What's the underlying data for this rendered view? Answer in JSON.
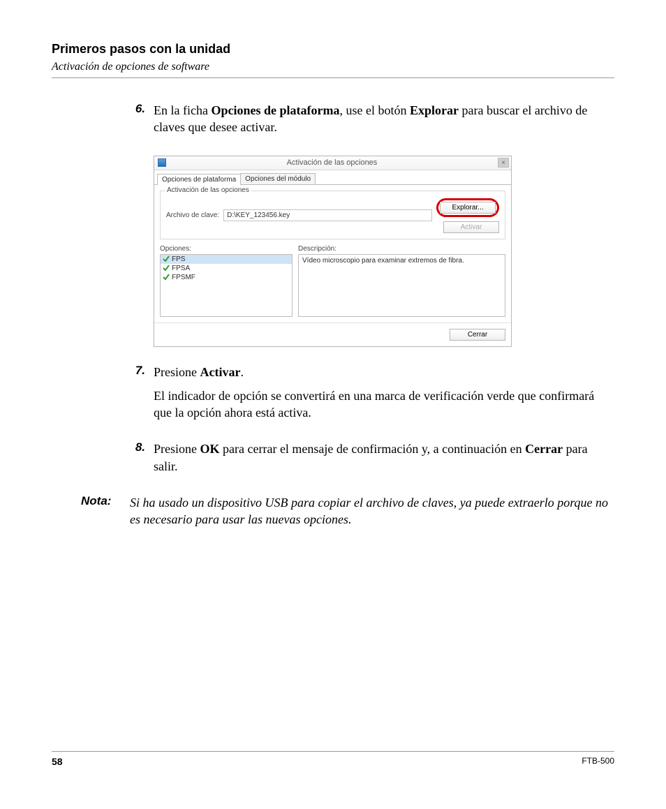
{
  "header": {
    "title": "Primeros pasos con la unidad",
    "subtitle": "Activación de opciones de software"
  },
  "steps": {
    "s6": {
      "num": "6.",
      "pre": "En la ficha ",
      "bold1": "Opciones de plataforma",
      "mid": ", use el botón ",
      "bold2": "Explorar",
      "post": " para buscar el archivo de claves que desee activar."
    },
    "s7": {
      "num": "7.",
      "line1_pre": "Presione ",
      "line1_bold": "Activar",
      "line1_post": ".",
      "line2": "El indicador de opción se convertirá en una marca de verificación verde que confirmará que la opción ahora está activa."
    },
    "s8": {
      "num": "8.",
      "pre": "Presione  ",
      "bold1": "OK",
      "mid": " para cerrar el mensaje de confirmación y, a continuación en ",
      "bold2": "Cerrar",
      "post": " para salir."
    }
  },
  "note": {
    "label": "Nota:",
    "text": "Si ha usado un dispositivo USB para copiar el archivo de claves, ya puede extraerlo porque no es necesario para usar las nuevas opciones."
  },
  "dialog": {
    "title": "Activación de las opciones",
    "close_glyph": "×",
    "tabs": {
      "platform": "Opciones de plataforma",
      "module": "Opciones del módulo"
    },
    "group_label": "Activación de las opciones",
    "file_label": "Archivo de clave:",
    "file_value": "D:\\KEY_123456.key",
    "explore_btn": "Explorar...",
    "activate_btn": "Activar",
    "options_label": "Opciones:",
    "description_label": "Descripción:",
    "options": [
      {
        "name": "FPS",
        "selected": true
      },
      {
        "name": "FPSA",
        "selected": false
      },
      {
        "name": "FPSMF",
        "selected": false
      }
    ],
    "description_text": "Vídeo microscopio para examinar extremos de fibra.",
    "close_btn": "Cerrar"
  },
  "footer": {
    "page": "58",
    "model": "FTB-500"
  }
}
